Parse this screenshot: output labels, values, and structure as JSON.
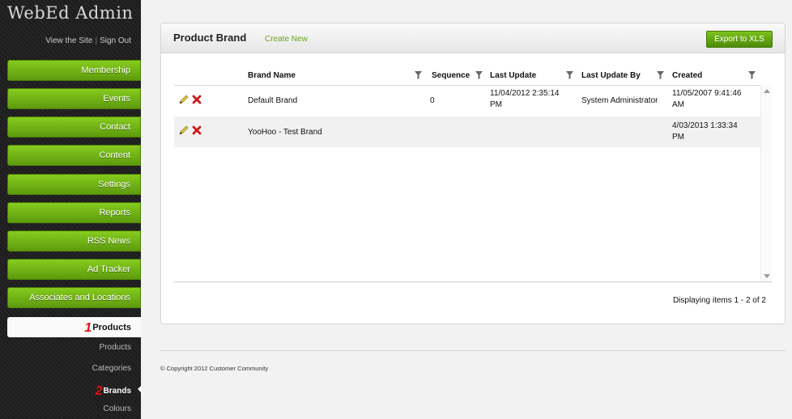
{
  "app": {
    "logo": "WebEd Admin",
    "view_site": "View the Site",
    "separator": "|",
    "sign_out": "Sign Out"
  },
  "sidebar": {
    "items": [
      {
        "label": "Membership"
      },
      {
        "label": "Events"
      },
      {
        "label": "Contact"
      },
      {
        "label": "Content"
      },
      {
        "label": "Settings"
      },
      {
        "label": "Reports"
      },
      {
        "label": "RSS News"
      },
      {
        "label": "Ad Tracker"
      },
      {
        "label": "Associates and Locations"
      }
    ],
    "active": {
      "badge": "1",
      "label": "Products"
    },
    "sub_items": [
      {
        "label": "Products"
      },
      {
        "label": "Categories"
      },
      {
        "label": "Brands",
        "badge": "2"
      },
      {
        "label": "Colours"
      }
    ]
  },
  "panel": {
    "title": "Product Brand",
    "create_new": "Create New",
    "export": "Export to XLS"
  },
  "grid": {
    "columns": [
      "Brand Name",
      "Sequence",
      "Last Update",
      "Last Update By",
      "Created"
    ],
    "rows": [
      {
        "brand": "Default Brand",
        "sequence": "0",
        "last_update_1": "11/04/2012 2:35:14",
        "last_update_2": "PM",
        "last_update_by": "System Administrator",
        "created_1": "11/05/2007 9:41:46",
        "created_2": "AM"
      },
      {
        "brand": "YooHoo - Test Brand",
        "sequence": "",
        "last_update_1": "",
        "last_update_2": "",
        "last_update_by": "",
        "created_1": "4/03/2013 1:33:34",
        "created_2": "PM"
      }
    ],
    "paging": "Displaying items 1 - 2 of 2"
  },
  "footer": {
    "copyright": "© Copyright 2012 Customer Community"
  },
  "colors": {
    "accent_green": "#6aa318",
    "nav_green": "#5d9a0d",
    "badge_red": "#e01010"
  },
  "icons": [
    "edit-pencil-icon",
    "delete-x-icon",
    "filter-icon",
    "scroll-up-icon",
    "scroll-down-icon"
  ]
}
